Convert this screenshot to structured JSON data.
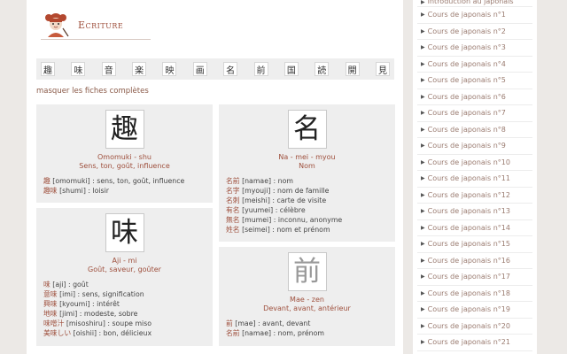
{
  "site": {
    "title": "Ecriture"
  },
  "kanji_bar": [
    "趣",
    "味",
    "音",
    "楽",
    "映",
    "画",
    "名",
    "前",
    "国",
    "読",
    "開",
    "見"
  ],
  "toggle_link": "masquer les fiches complètes",
  "cards_left": [
    {
      "kanji": "趣",
      "reading": "Omomuki - shu",
      "meaning": "Sens, ton, goût, influence",
      "vocab": [
        {
          "word": "趣",
          "reading": "[omomuki]",
          "def": "sens, ton, goût, influence"
        },
        {
          "word": "趣味",
          "reading": "[shumi]",
          "def": "loisir"
        }
      ]
    },
    {
      "kanji": "味",
      "reading": "Aji - mi",
      "meaning": "Goût, saveur, goûter",
      "vocab": [
        {
          "word": "味",
          "reading": "[aji]",
          "def": "goût"
        },
        {
          "word": "意味",
          "reading": "[imi]",
          "def": "sens, signification"
        },
        {
          "word": "興味",
          "reading": "[kyoumi]",
          "def": "intérêt"
        },
        {
          "word": "地味",
          "reading": "[jimi]",
          "def": "modeste, sobre"
        },
        {
          "word": "味噌汁",
          "reading": "[misoshiru]",
          "def": "soupe miso"
        },
        {
          "word": "美味しい",
          "reading": "[oishii]",
          "def": "bon, délicieux"
        }
      ]
    }
  ],
  "cards_right": [
    {
      "kanji": "名",
      "reading": "Na - mei - myou",
      "meaning": "Nom",
      "vocab": [
        {
          "word": "名前",
          "reading": "[namae]",
          "def": "nom"
        },
        {
          "word": "名字",
          "reading": "[myouji]",
          "def": "nom de famille"
        },
        {
          "word": "名刺",
          "reading": "[meishi]",
          "def": "carte de visite"
        },
        {
          "word": "有名",
          "reading": "[yuumei]",
          "def": "célèbre"
        },
        {
          "word": "無名",
          "reading": "[mumei]",
          "def": "inconnu, anonyme"
        },
        {
          "word": "姓名",
          "reading": "[seimei]",
          "def": "nom et prénom"
        }
      ]
    },
    {
      "kanji": "前",
      "reading": "Mae - zen",
      "meaning": "Devant, avant, antérieur",
      "vocab": [
        {
          "word": "前",
          "reading": "[mae]",
          "def": "avant, devant"
        },
        {
          "word": "名前",
          "reading": "[namae]",
          "def": "nom, prénom"
        }
      ]
    }
  ],
  "sidebar": {
    "items": [
      "Introduction au japonais",
      "Cours de japonais n°1",
      "Cours de japonais n°2",
      "Cours de japonais n°3",
      "Cours de japonais n°4",
      "Cours de japonais n°5",
      "Cours de japonais n°6",
      "Cours de japonais n°7",
      "Cours de japonais n°8",
      "Cours de japonais n°9",
      "Cours de japonais n°10",
      "Cours de japonais n°11",
      "Cours de japonais n°12",
      "Cours de japonais n°13",
      "Cours de japonais n°14",
      "Cours de japonais n°15",
      "Cours de japonais n°16",
      "Cours de japonais n°17",
      "Cours de japonais n°18",
      "Cours de japonais n°19",
      "Cours de japonais n°20",
      "Cours de japonais n°21"
    ]
  }
}
